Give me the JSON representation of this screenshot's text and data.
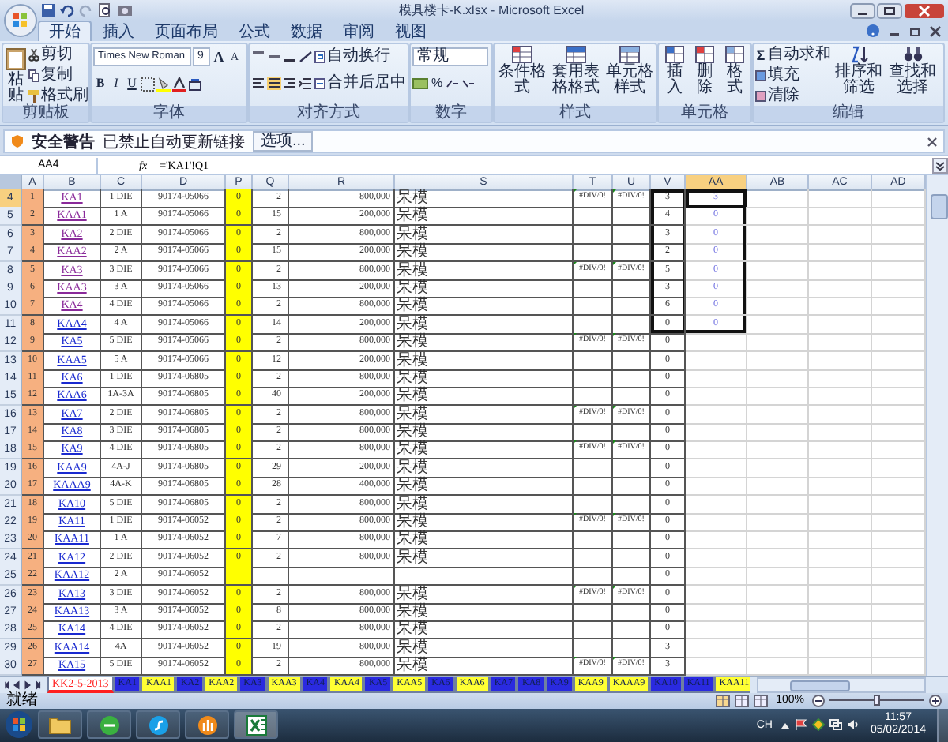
{
  "window": {
    "title": "模具楼卡-K.xlsx - Microsoft Excel"
  },
  "ribbon_tabs": [
    {
      "label": "开始",
      "selected": true
    },
    {
      "label": "插入",
      "selected": false
    },
    {
      "label": "页面布局",
      "selected": false
    },
    {
      "label": "公式",
      "selected": false
    },
    {
      "label": "数据",
      "selected": false
    },
    {
      "label": "审阅",
      "selected": false
    },
    {
      "label": "视图",
      "selected": false
    }
  ],
  "clipboard": {
    "title": "剪贴板",
    "paste": "粘贴",
    "cut": "剪切",
    "copy": "复制",
    "format_painter": "格式刷"
  },
  "font": {
    "title": "字体",
    "font_name": "Times New Roman",
    "font_size": "9",
    "size_buttons": [
      "A",
      "A"
    ],
    "style_buttons": [
      "B",
      "I",
      "U"
    ]
  },
  "alignment": {
    "title": "对齐方式",
    "wrap_text": "自动换行",
    "merge_center": "合并后居中"
  },
  "number": {
    "title": "数字",
    "format": "常规",
    "percent": "%"
  },
  "styles": {
    "title": "样式",
    "buttons": [
      "条件格式",
      "套用表格格式",
      "单元格样式"
    ]
  },
  "cells_group": {
    "title": "单元格",
    "buttons": [
      "插入",
      "删除",
      "格式"
    ]
  },
  "editing": {
    "title": "编辑",
    "autosum_symbol": "Σ",
    "items": [
      "自动求和",
      "填充",
      "清除"
    ],
    "buttons": [
      "排序和筛选",
      "查找和选择"
    ]
  },
  "security_bar": {
    "title": "安全警告",
    "message": "已禁止自动更新链接",
    "button": "选项..."
  },
  "formula_bar": {
    "name_box": "AA4",
    "function_label": "fx",
    "formula": "='KA1'!Q1"
  },
  "columns": [
    {
      "label": "A",
      "selected": false
    },
    {
      "label": "B",
      "selected": false
    },
    {
      "label": "C",
      "selected": false
    },
    {
      "label": "D",
      "selected": false
    },
    {
      "label": "P",
      "selected": false
    },
    {
      "label": "Q",
      "selected": false
    },
    {
      "label": "R",
      "selected": false
    },
    {
      "label": "S",
      "selected": false
    },
    {
      "label": "T",
      "selected": false
    },
    {
      "label": "U",
      "selected": false
    },
    {
      "label": "V",
      "selected": false
    },
    {
      "label": "AA",
      "selected": true
    },
    {
      "label": "AB",
      "selected": false
    },
    {
      "label": "AC",
      "selected": false
    },
    {
      "label": "AD",
      "selected": false
    }
  ],
  "rows": [
    {
      "number": "4",
      "selected": true,
      "link_visited": true,
      "boxed": true,
      "a": "1",
      "b": "KA1",
      "c": "1 DIE",
      "d": "90174-05066",
      "p": "0",
      "q": "2",
      "r": "800,000",
      "s": "呆模",
      "t": "#DIV/0!",
      "u": "#DIV/0!",
      "v": "3",
      "aa": "3"
    },
    {
      "number": "5",
      "selected": false,
      "link_visited": true,
      "boxed": true,
      "a": "2",
      "b": "KAA1",
      "c": "1 A",
      "d": "90174-05066",
      "p": "0",
      "q": "15",
      "r": "200,000",
      "s": "呆模",
      "v": "4",
      "aa": "0"
    },
    {
      "number": "6",
      "selected": false,
      "link_visited": true,
      "boxed": true,
      "a": "3",
      "b": "KA2",
      "c": "2 DIE",
      "d": "90174-05066",
      "p": "0",
      "q": "2",
      "r": "800,000",
      "s": "呆模",
      "v": "3",
      "aa": "0"
    },
    {
      "number": "7",
      "selected": false,
      "link_visited": true,
      "boxed": true,
      "a": "4",
      "b": "KAA2",
      "c": "2 A",
      "d": "90174-05066",
      "p": "0",
      "q": "15",
      "r": "200,000",
      "s": "呆模",
      "v": "2",
      "aa": "0"
    },
    {
      "number": "8",
      "selected": false,
      "link_visited": true,
      "boxed": true,
      "a": "5",
      "b": "KA3",
      "c": "3 DIE",
      "d": "90174-05066",
      "p": "0",
      "q": "2",
      "r": "800,000",
      "s": "呆模",
      "t": "#DIV/0!",
      "u": "#DIV/0!",
      "v": "5",
      "aa": "0"
    },
    {
      "number": "9",
      "selected": false,
      "link_visited": true,
      "boxed": true,
      "a": "6",
      "b": "KAA3",
      "c": "3 A",
      "d": "90174-05066",
      "p": "0",
      "q": "13",
      "r": "200,000",
      "s": "呆模",
      "v": "3",
      "aa": "0"
    },
    {
      "number": "10",
      "selected": false,
      "link_visited": true,
      "boxed": true,
      "a": "7",
      "b": "KA4",
      "c": "4 DIE",
      "d": "90174-05066",
      "p": "0",
      "q": "2",
      "r": "800,000",
      "s": "呆模",
      "v": "6",
      "aa": "0"
    },
    {
      "number": "11",
      "selected": false,
      "link_visited": false,
      "boxed": true,
      "a": "8",
      "b": "KAA4",
      "c": "4 A",
      "d": "90174-05066",
      "p": "0",
      "q": "14",
      "r": "200,000",
      "s": "呆模",
      "v": "0",
      "aa": "0"
    },
    {
      "number": "12",
      "selected": false,
      "link_visited": false,
      "boxed": false,
      "a": "9",
      "b": "KA5",
      "c": "5 DIE",
      "d": "90174-05066",
      "p": "0",
      "q": "2",
      "r": "800,000",
      "s": "呆模",
      "t": "#DIV/0!",
      "u": "#DIV/0!",
      "v": "0"
    },
    {
      "number": "13",
      "selected": false,
      "link_visited": false,
      "boxed": false,
      "a": "10",
      "b": "KAA5",
      "c": "5 A",
      "d": "90174-05066",
      "p": "0",
      "q": "12",
      "r": "200,000",
      "s": "呆模",
      "v": "0"
    },
    {
      "number": "14",
      "selected": false,
      "link_visited": false,
      "boxed": false,
      "a": "11",
      "b": "KA6",
      "c": "1 DIE",
      "d": "90174-06805",
      "p": "0",
      "q": "2",
      "r": "800,000",
      "s": "呆模",
      "v": "0"
    },
    {
      "number": "15",
      "selected": false,
      "link_visited": false,
      "boxed": false,
      "a": "12",
      "b": "KAA6",
      "c": "1A-3A",
      "d": "90174-06805",
      "p": "0",
      "q": "40",
      "r": "200,000",
      "s": "呆模",
      "v": "0"
    },
    {
      "number": "16",
      "selected": false,
      "link_visited": false,
      "boxed": false,
      "a": "13",
      "b": "KA7",
      "c": "2 DIE",
      "d": "90174-06805",
      "p": "0",
      "q": "2",
      "r": "800,000",
      "s": "呆模",
      "t": "#DIV/0!",
      "u": "#DIV/0!",
      "v": "0"
    },
    {
      "number": "17",
      "selected": false,
      "link_visited": false,
      "boxed": false,
      "a": "14",
      "b": "KA8",
      "c": "3 DIE",
      "d": "90174-06805",
      "p": "0",
      "q": "2",
      "r": "800,000",
      "s": "呆模",
      "v": "0"
    },
    {
      "number": "18",
      "selected": false,
      "link_visited": false,
      "boxed": false,
      "a": "15",
      "b": "KA9",
      "c": "4 DIE",
      "d": "90174-06805",
      "p": "0",
      "q": "2",
      "r": "800,000",
      "s": "呆模",
      "t": "#DIV/0!",
      "u": "#DIV/0!",
      "v": "0"
    },
    {
      "number": "19",
      "selected": false,
      "link_visited": false,
      "boxed": false,
      "a": "16",
      "b": "KAA9",
      "c": "4A-J",
      "d": "90174-06805",
      "p": "0",
      "q": "29",
      "r": "200,000",
      "s": "呆模",
      "v": "0"
    },
    {
      "number": "20",
      "selected": false,
      "link_visited": false,
      "boxed": false,
      "a": "17",
      "b": "KAAA9",
      "c": "4A-K",
      "d": "90174-06805",
      "p": "0",
      "q": "28",
      "r": "400,000",
      "s": "呆模",
      "v": "0"
    },
    {
      "number": "21",
      "selected": false,
      "link_visited": false,
      "boxed": false,
      "a": "18",
      "b": "KA10",
      "c": "5 DIE",
      "d": "90174-06805",
      "p": "0",
      "q": "2",
      "r": "800,000",
      "s": "呆模",
      "v": "0"
    },
    {
      "number": "22",
      "selected": false,
      "link_visited": false,
      "boxed": false,
      "a": "19",
      "b": "KA11",
      "c": "1 DIE",
      "d": "90174-06052",
      "p": "0",
      "q": "2",
      "r": "800,000",
      "s": "呆模",
      "t": "#DIV/0!",
      "u": "#DIV/0!",
      "v": "0"
    },
    {
      "number": "23",
      "selected": false,
      "link_visited": false,
      "boxed": false,
      "a": "20",
      "b": "KAA11",
      "c": "1 A",
      "d": "90174-06052",
      "p": "0",
      "q": "7",
      "r": "800,000",
      "s": "呆模",
      "v": "0"
    },
    {
      "number": "24",
      "selected": false,
      "link_visited": false,
      "boxed": false,
      "a": "21",
      "b": "KA12",
      "c": "2 DIE",
      "d": "90174-06052",
      "p": "0",
      "q": "2",
      "r": "800,000",
      "s": "呆模",
      "v": "0"
    },
    {
      "number": "25",
      "selected": false,
      "link_visited": false,
      "boxed": false,
      "a": "22",
      "b": "KAA12",
      "c": "2 A",
      "d": "90174-06052",
      "v": "0"
    },
    {
      "number": "26",
      "selected": false,
      "link_visited": false,
      "boxed": false,
      "a": "23",
      "b": "KA13",
      "c": "3 DIE",
      "d": "90174-06052",
      "p": "0",
      "q": "2",
      "r": "800,000",
      "s": "呆模",
      "t": "#DIV/0!",
      "u": "#DIV/0!",
      "v": "0"
    },
    {
      "number": "27",
      "selected": false,
      "link_visited": false,
      "boxed": false,
      "a": "24",
      "b": "KAA13",
      "c": "3 A",
      "d": "90174-06052",
      "p": "0",
      "q": "8",
      "r": "800,000",
      "s": "呆模",
      "v": "0"
    },
    {
      "number": "28",
      "selected": false,
      "link_visited": false,
      "boxed": false,
      "a": "25",
      "b": "KA14",
      "c": "4 DIE",
      "d": "90174-06052",
      "p": "0",
      "q": "2",
      "r": "800,000",
      "s": "呆模",
      "v": "0"
    },
    {
      "number": "29",
      "selected": false,
      "link_visited": false,
      "boxed": false,
      "a": "26",
      "b": "KAA14",
      "c": "4A",
      "d": "90174-06052",
      "p": "0",
      "q": "19",
      "r": "800,000",
      "s": "呆模",
      "v": "3"
    },
    {
      "number": "30",
      "selected": false,
      "link_visited": false,
      "boxed": false,
      "a": "27",
      "b": "KA15",
      "c": "5 DIE",
      "d": "90174-06052",
      "p": "0",
      "q": "2",
      "r": "800,000",
      "s": "呆模",
      "t": "#DIV/0!",
      "u": "#DIV/0!",
      "v": "3"
    }
  ],
  "sheet_tabs": [
    {
      "label": "KK2-5-2013",
      "selected": true,
      "color": "#ff2020"
    },
    {
      "label": "KA1",
      "selected": false,
      "color": "#2a2ae0"
    },
    {
      "label": "KAA1",
      "selected": false,
      "color": "#ffff33"
    },
    {
      "label": "KA2",
      "selected": false,
      "color": "#2a2ae0"
    },
    {
      "label": "KAA2",
      "selected": false,
      "color": "#ffff33"
    },
    {
      "label": "KA3",
      "selected": false,
      "color": "#2a2ae0"
    },
    {
      "label": "KAA3",
      "selected": false,
      "color": "#ffff33"
    },
    {
      "label": "KA4",
      "selected": false,
      "color": "#2a2ae0"
    },
    {
      "label": "KAA4",
      "selected": false,
      "color": "#ffff33"
    },
    {
      "label": "KA5",
      "selected": false,
      "color": "#2a2ae0"
    },
    {
      "label": "KAA5",
      "selected": false,
      "color": "#ffff33"
    },
    {
      "label": "KA6",
      "selected": false,
      "color": "#2a2ae0"
    },
    {
      "label": "KAA6",
      "selected": false,
      "color": "#ffff33"
    },
    {
      "label": "KA7",
      "selected": false,
      "color": "#2a2ae0"
    },
    {
      "label": "KA8",
      "selected": false,
      "color": "#2a2ae0"
    },
    {
      "label": "KA9",
      "selected": false,
      "color": "#2a2ae0"
    },
    {
      "label": "KAA9",
      "selected": false,
      "color": "#ffff33"
    },
    {
      "label": "KAAA9",
      "selected": false,
      "color": "#ffff33"
    },
    {
      "label": "KA10",
      "selected": false,
      "color": "#2a2ae0"
    },
    {
      "label": "KA11",
      "selected": false,
      "color": "#2a2ae0"
    },
    {
      "label": "KAA11",
      "selected": false,
      "color": "#ffff33"
    }
  ],
  "status_bar": {
    "status": "就绪",
    "zoom": "100%",
    "zoom_slider": {
      "level": 0.5
    }
  },
  "taskbar": {
    "language": "CH",
    "time": "11:57",
    "date": "05/02/2014"
  }
}
